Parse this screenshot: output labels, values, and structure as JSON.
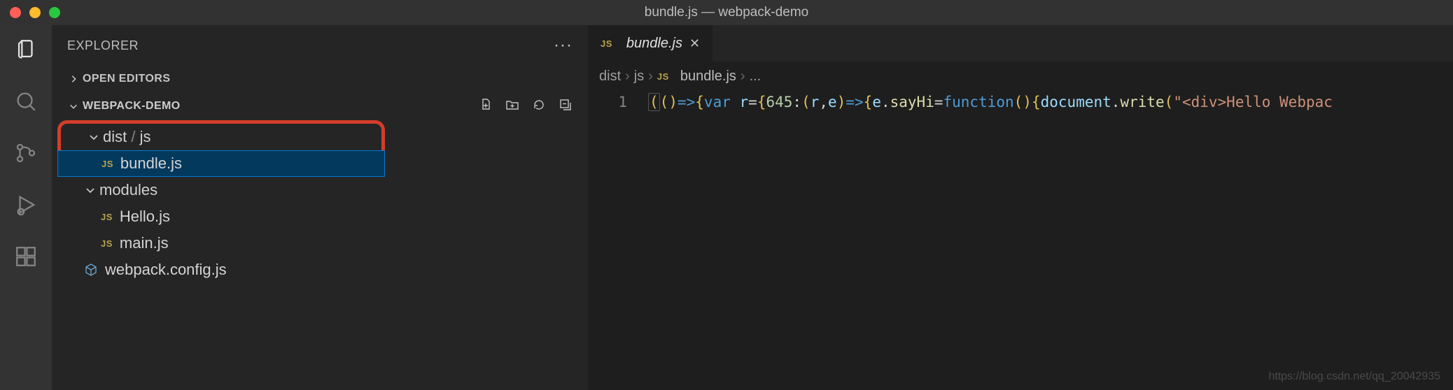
{
  "window": {
    "title": "bundle.js — webpack-demo"
  },
  "explorer": {
    "title": "EXPLORER",
    "openEditors": "OPEN EDITORS",
    "workspace": "WEBPACK-DEMO",
    "tree": {
      "distjs_label_a": "dist",
      "distjs_label_sep": " / ",
      "distjs_label_b": "js",
      "bundle": "bundle.js",
      "modules": "modules",
      "hello": "Hello.js",
      "main": "main.js",
      "webpack": "webpack.config.js"
    }
  },
  "tab": {
    "filename": "bundle.js"
  },
  "breadcrumb": {
    "p0": "dist",
    "p1": "js",
    "p2": "bundle.js",
    "p3": "..."
  },
  "code": {
    "lineNumber": "1",
    "tokens": {
      "t0": "(",
      "t1": "(",
      "t2": ")",
      "t3": "=>",
      "t4": "{",
      "t5": "var",
      "t6": " ",
      "t7": "r",
      "t8": "=",
      "t9": "{",
      "t10": "645",
      "t11": ":",
      "t12": "(",
      "t13": "r",
      "t14": ",",
      "t15": "e",
      "t16": ")",
      "t17": "=>",
      "t18": "{",
      "t19": "e",
      "t20": ".",
      "t21": "sayHi",
      "t22": "=",
      "t23": "function",
      "t24": "(",
      "t25": ")",
      "t26": "{",
      "t27": "document",
      "t28": ".",
      "t29": "write",
      "t30": "(",
      "t31": "\"<div>Hello Webpac"
    }
  },
  "watermark": "https://blog.csdn.net/qq_20042935"
}
